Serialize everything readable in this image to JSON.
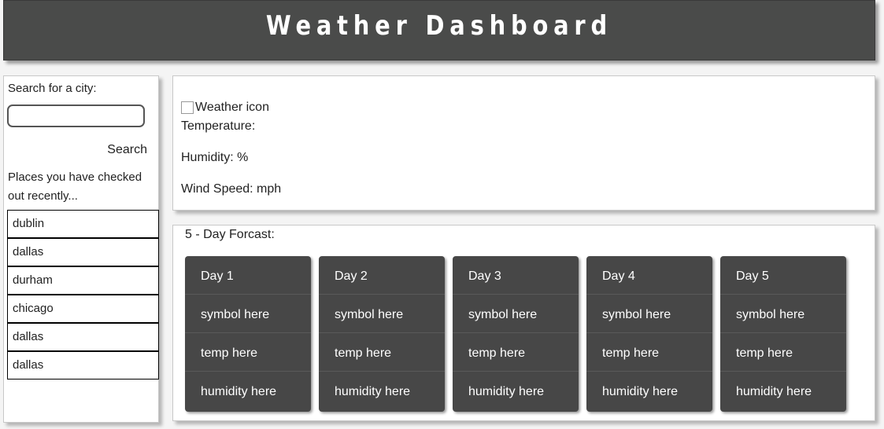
{
  "header": {
    "title": "Weather Dashboard"
  },
  "sidebar": {
    "search_label": "Search for a city:",
    "search_placeholder": "",
    "search_value": "",
    "search_button": "Search",
    "recent_label": "Places you have checked out recently...",
    "recent_items": [
      "dublin",
      "dallas",
      "durham",
      "chicago",
      "dallas",
      "dallas"
    ]
  },
  "current": {
    "icon_alt": "Weather icon",
    "temperature": "Temperature:",
    "humidity": "Humidity: %",
    "wind": "Wind Speed: mph"
  },
  "forecast": {
    "title": "5 - Day Forcast:",
    "days": [
      {
        "day": "Day 1",
        "symbol": "symbol here",
        "temp": "temp here",
        "humidity": "humidity here"
      },
      {
        "day": "Day 2",
        "symbol": "symbol here",
        "temp": "temp here",
        "humidity": "humidity here"
      },
      {
        "day": "Day 3",
        "symbol": "symbol here",
        "temp": "temp here",
        "humidity": "humidity here"
      },
      {
        "day": "Day 4",
        "symbol": "symbol here",
        "temp": "temp here",
        "humidity": "humidity here"
      },
      {
        "day": "Day 5",
        "symbol": "symbol here",
        "temp": "temp here",
        "humidity": "humidity here"
      }
    ]
  },
  "colors": {
    "header_bg": "#4a4b4a",
    "card_bg": "#474747"
  }
}
